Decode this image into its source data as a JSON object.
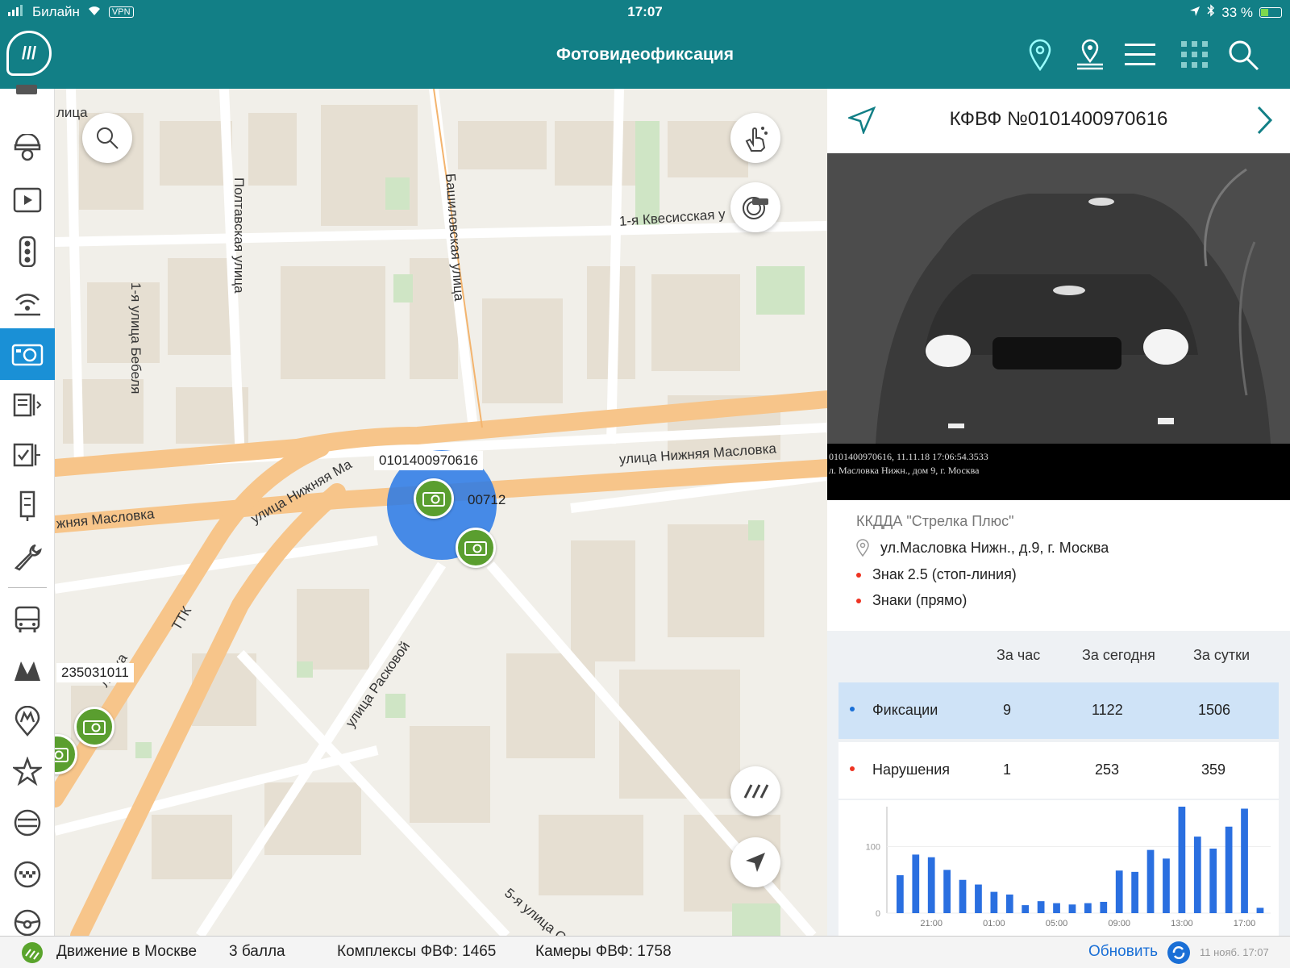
{
  "status_bar": {
    "carrier": "Билайн",
    "vpn": "VPN",
    "time": "17:07",
    "battery": "33 %"
  },
  "header": {
    "title": "Фотовидеофиксация",
    "icons": [
      "location-pin-icon",
      "map-pin-icon",
      "menu-icon",
      "grid-icon",
      "search-icon"
    ]
  },
  "sidebar": {
    "items": [
      {
        "icon": "dome-camera-icon"
      },
      {
        "icon": "video-icon"
      },
      {
        "icon": "traffic-light-icon"
      },
      {
        "icon": "broadcast-icon"
      },
      {
        "icon": "photo-camera-icon",
        "active": true
      },
      {
        "icon": "board-icon"
      },
      {
        "icon": "checklist-icon"
      },
      {
        "icon": "column-sign-icon"
      },
      {
        "icon": "wrench-icon"
      },
      {
        "icon": "bus-icon"
      },
      {
        "icon": "metro-icon"
      },
      {
        "icon": "metro-station-icon"
      },
      {
        "icon": "star-icon"
      },
      {
        "icon": "road-icon"
      },
      {
        "icon": "taxi-icon"
      },
      {
        "icon": "steering-wheel-icon"
      }
    ]
  },
  "map": {
    "streets": {
      "s1": "1-я улица Бебеля",
      "s2": "Полтавская улица",
      "s3": "Башиловская улица",
      "s4": "1-я Квесисская у",
      "s5": "улица Нижняя Масловка",
      "s6": "улица Нижняя Ма",
      "s7": "жняя Масловка",
      "s8": "ТТК",
      "s9": "улица Расковой",
      "s10": "5-я улица С",
      "s11": "ловка",
      "s12": "лица"
    },
    "camera_labels": {
      "c1": "0101400970616",
      "c2": "00712",
      "c3": "235031011"
    }
  },
  "panel": {
    "title": "КФВФ №0101400970616",
    "caption_line1": "0101400970616, 11.11.18 17:06:54.3533",
    "caption_line2": "л. Масловка Нижн., дом 9, г. Москва",
    "operator": "ККДДА \"Стрелка Плюс\"",
    "address": "ул.Масловка Нижн., д.9, г. Москва",
    "sign1": "Знак 2.5 (стоп-линия)",
    "sign2": "Знаки (прямо)",
    "columns": [
      "За час",
      "За сегодня",
      "За сутки"
    ],
    "rows": [
      {
        "label": "Фиксации",
        "hour": "9",
        "today": "1122",
        "day": "1506"
      },
      {
        "label": "Нарушения",
        "hour": "1",
        "today": "253",
        "day": "359"
      }
    ]
  },
  "chart_data": {
    "type": "bar",
    "title": "",
    "ylim": [
      0,
      160
    ],
    "yticks": [
      "0",
      "100"
    ],
    "xticks": [
      "21:00",
      "01:00",
      "05:00",
      "09:00",
      "13:00",
      "17:00"
    ],
    "values": [
      57,
      88,
      84,
      65,
      50,
      43,
      32,
      28,
      12,
      18,
      15,
      13,
      15,
      17,
      64,
      62,
      95,
      82,
      166,
      115,
      97,
      130,
      157,
      8
    ],
    "color": "#2a6fe0"
  },
  "bottom_bar": {
    "traffic": "Движение в Москве",
    "score": "3 балла",
    "complexes": "Комплексы ФВФ: 1465",
    "cameras": "Камеры ФВФ: 1758",
    "refresh": "Обновить",
    "timestamp": "11 нояб. 17:07"
  }
}
